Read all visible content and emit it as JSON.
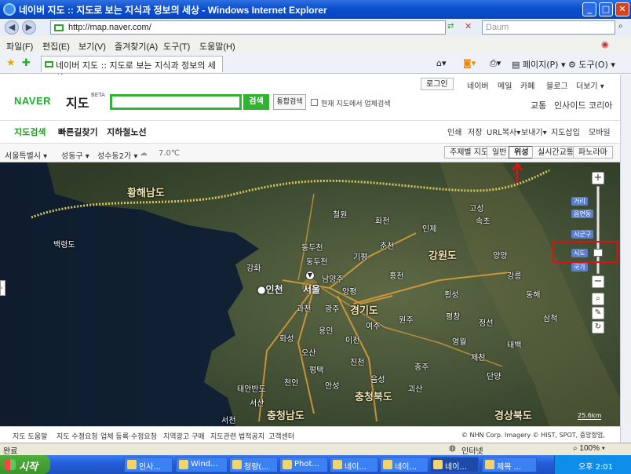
{
  "window": {
    "title": "네이버 지도 :: 지도로 보는 지식과 정보의 세상 - Windows Internet Explorer",
    "url": "http://map.naver.com/",
    "search_placeholder": "Daum"
  },
  "menu": [
    "파일(F)",
    "편집(E)",
    "보기(V)",
    "즐겨찾기(A)",
    "도구(T)",
    "도움말(H)"
  ],
  "tab": {
    "title": "네이버 지도 :: 지도로 보는 지식과 정보의 세상",
    "page_label": "페이지(P)",
    "tools_label": "도구(O)"
  },
  "naver": {
    "logo": "NAVER",
    "title": "지도",
    "beta": "BETA",
    "search_button": "검색",
    "integrated_button": "통합검색",
    "checkbox_label": "현재 지도에서 업체검색",
    "top_links": [
      "로그인",
      "네이버",
      "메일",
      "카페",
      "블로그",
      "더보기"
    ],
    "right_links": [
      "교통",
      "인사이드 코리아"
    ],
    "nav_tabs": [
      "지도검색",
      "빠른길찾기",
      "지하철노선"
    ],
    "tools": [
      "인쇄",
      "저장",
      "URL복사",
      "보내기",
      "지도삽입",
      "모바일"
    ],
    "location": [
      "서울특별시",
      "성동구",
      "성수동2가"
    ],
    "weather": "7.0℃",
    "map_types": [
      "주제별 지도",
      "일반",
      "위성",
      "실시간교통",
      "파노라마"
    ],
    "selected_map_type": "위성"
  },
  "map": {
    "regions": [
      "황해남도",
      "강원도",
      "경기도",
      "충청북도",
      "충청남도",
      "경상북도"
    ],
    "cities": [
      "인천",
      "서울"
    ],
    "places": [
      "백령도",
      "철원",
      "화천",
      "인제",
      "동두천",
      "기평",
      "춘천",
      "강화",
      "남양주",
      "홍천",
      "양평",
      "횡성",
      "과천",
      "광주",
      "여주",
      "원주",
      "평창",
      "화성",
      "용인",
      "오산",
      "이천",
      "영월",
      "평택",
      "안성",
      "충주",
      "제천",
      "단양",
      "천안",
      "태백",
      "동해",
      "삼척",
      "고성",
      "속초",
      "양양",
      "강릉",
      "정선",
      "진천",
      "음성",
      "괴산",
      "태안반도",
      "서산",
      "서천",
      "동두천"
    ],
    "zoom_tags": [
      "거리",
      "읍면동",
      "시군구",
      "시도",
      "국가"
    ],
    "scale": "25.6km",
    "copyright": "© NHN Corp. Imagery © HIST, SPOT, 중앙항업,"
  },
  "footer_links": [
    "지도 도움말",
    "지도 수정요청",
    "업체 등록·수정요청",
    "지역광고 구매",
    "지도관련 법적공지",
    "고객센터"
  ],
  "status": {
    "left": "완료",
    "zone": "인터넷",
    "zoom": "100%"
  },
  "taskbar": {
    "start": "시작",
    "tasks": [
      "인사...",
      "Wind...",
      "청량(...",
      "Phot...",
      "네이...",
      "네이...",
      "네이...",
      "제목 ..."
    ],
    "clock": "오후 2:01"
  }
}
